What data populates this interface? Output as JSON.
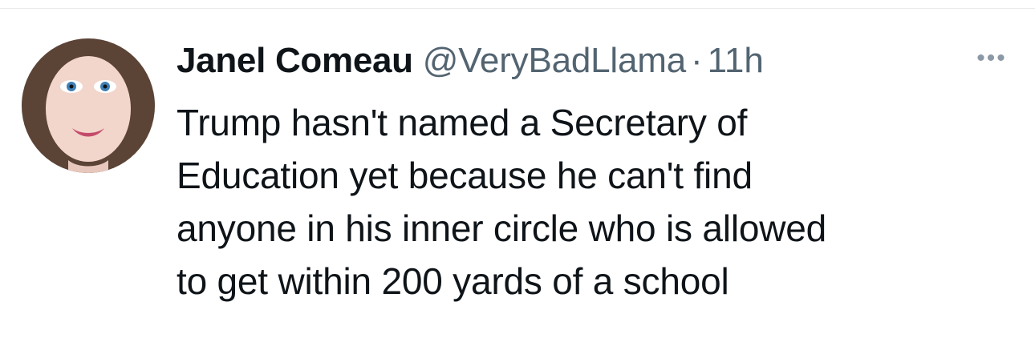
{
  "tweet": {
    "author": {
      "display_name": "Janel Comeau",
      "handle": "@VeryBadLlama"
    },
    "separator": "·",
    "timestamp": "11h",
    "more_icon": "more-horizontal-icon",
    "text_lines": [
      "Trump hasn't named a Secretary of",
      "Education yet because he can't find",
      "anyone in his inner circle who is allowed",
      "to get within 200 yards of a school"
    ]
  },
  "colors": {
    "text_primary": "#0f1419",
    "text_secondary": "#536471",
    "divider": "#e7e9ea"
  }
}
